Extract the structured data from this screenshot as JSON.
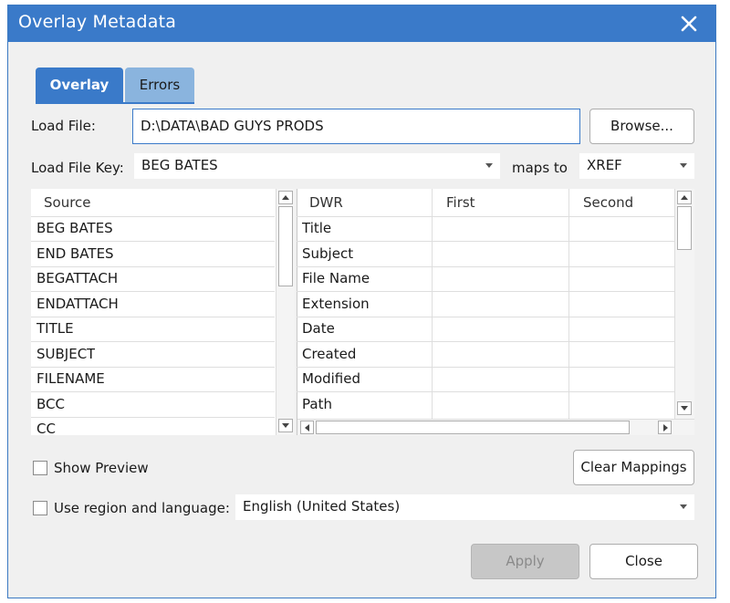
{
  "window": {
    "title": "Overlay Metadata",
    "close_icon": "close-icon"
  },
  "tabs": [
    {
      "label": "Overlay",
      "active": true
    },
    {
      "label": "Errors",
      "active": false
    }
  ],
  "load_file": {
    "label": "Load File:",
    "value": "D:\\DATA\\BAD GUYS PRODS",
    "browse_label": "Browse..."
  },
  "load_file_key": {
    "label": "Load File Key:",
    "value": "BEG BATES",
    "maps_to_label": "maps to",
    "maps_to_value": "XREF"
  },
  "source_list": {
    "header": "Source",
    "items": [
      "BEG BATES",
      "END BATES",
      "BEGATTACH",
      "ENDATTACH",
      "TITLE",
      "SUBJECT",
      "FILENAME",
      "BCC",
      "CC"
    ]
  },
  "mapping_grid": {
    "columns": [
      "DWR",
      "First",
      "Second"
    ],
    "rows": [
      "Title",
      "Subject",
      "File Name",
      "Extension",
      "Date",
      "Created",
      "Modified",
      "Path"
    ]
  },
  "show_preview": {
    "label": "Show Preview",
    "checked": false
  },
  "clear_mappings_label": "Clear Mappings",
  "region": {
    "label": "Use region and language:",
    "checked": false,
    "value": "English (United States)"
  },
  "footer": {
    "apply_label": "Apply",
    "close_label": "Close"
  },
  "colors": {
    "accent": "#3a7ac9",
    "inactive_tab": "#8ab4de",
    "dialog_bg": "#f0f0f0"
  }
}
